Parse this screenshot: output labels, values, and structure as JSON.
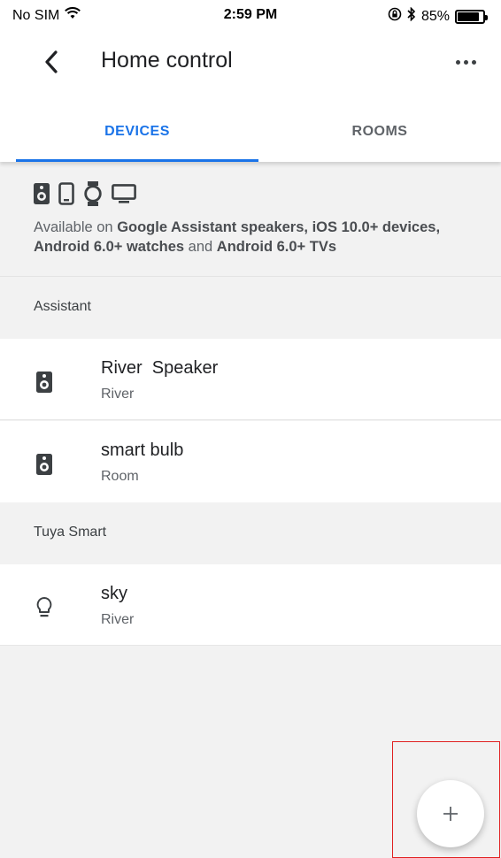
{
  "status_bar": {
    "carrier": "No SIM",
    "time": "2:59 PM",
    "battery": "85%",
    "battery_level": 0.85,
    "icons": [
      "wifi-icon",
      "orientation-lock-icon",
      "bluetooth-icon",
      "battery-icon"
    ]
  },
  "header": {
    "title": "Home control",
    "back_icon": "back-chevron-icon",
    "more_icon": "more-options-icon"
  },
  "tabs": [
    {
      "label": "DEVICES",
      "active": true
    },
    {
      "label": "ROOMS",
      "active": false
    }
  ],
  "availability": {
    "icons": [
      "speaker-icon",
      "phone-icon",
      "watch-icon",
      "tv-icon"
    ],
    "text_prefix": "Available on ",
    "speakers": "Google Assistant speakers, iOS 10.0+ devices,",
    "sep1": " ",
    "watches": "Android 6.0+ watches",
    "sep2": " and ",
    "tvs": "Android 6.0+ TVs"
  },
  "sections": [
    {
      "header": "Assistant",
      "devices": [
        {
          "name": "River  Speaker",
          "room": "River",
          "icon": "speaker-icon"
        },
        {
          "name": "smart bulb",
          "room": "Room",
          "icon": "speaker-icon"
        }
      ]
    },
    {
      "header": "Tuya Smart",
      "devices": [
        {
          "name": "sky",
          "room": "River",
          "icon": "lightbulb-icon"
        }
      ]
    }
  ],
  "fab": {
    "icon": "add-icon",
    "symbol": "+"
  },
  "colors": {
    "accent": "#1a73e8",
    "highlight": "#e02020",
    "background": "#f2f2f2"
  }
}
